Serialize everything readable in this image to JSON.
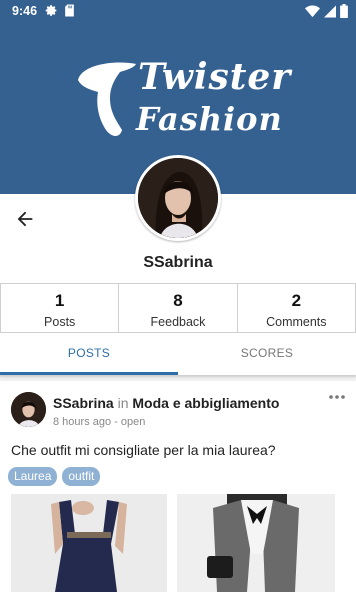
{
  "status_bar": {
    "time": "9:46"
  },
  "brand": {
    "line1": "Twister",
    "line2": "Fashion"
  },
  "profile": {
    "username": "SSabrina"
  },
  "stats": [
    {
      "value": "1",
      "label": "Posts"
    },
    {
      "value": "8",
      "label": "Feedback"
    },
    {
      "value": "2",
      "label": "Comments"
    }
  ],
  "tabs": [
    {
      "label": "POSTS",
      "active": true
    },
    {
      "label": "SCORES",
      "active": false
    }
  ],
  "post": {
    "author": "SSabrina",
    "in_word": "in",
    "category": "Moda e abbigliamento",
    "meta": "8 hours ago - open",
    "text": "Che outfit mi consigliate per la mia laurea?",
    "tags": [
      "Laurea",
      "outfit"
    ]
  },
  "colors": {
    "header": "#356191",
    "accent": "#2f6fa7",
    "tag": "#8fb1d3"
  }
}
